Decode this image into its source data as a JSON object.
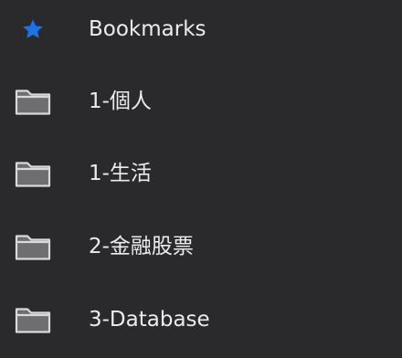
{
  "menu": {
    "items": [
      {
        "label": "Bookmarks",
        "icon": "star-icon",
        "color": "#1a73e8"
      },
      {
        "label": "1-個人",
        "icon": "folder-icon"
      },
      {
        "label": "1-生活",
        "icon": "folder-icon"
      },
      {
        "label": "2-金融股票",
        "icon": "folder-icon"
      },
      {
        "label": "3-Database",
        "icon": "folder-icon"
      }
    ]
  },
  "colors": {
    "background": "#2a2a2c",
    "text": "#ececec",
    "folder_fill": "#6e6e70",
    "folder_stroke": "#d9d9d9",
    "star": "#1a73e8"
  }
}
